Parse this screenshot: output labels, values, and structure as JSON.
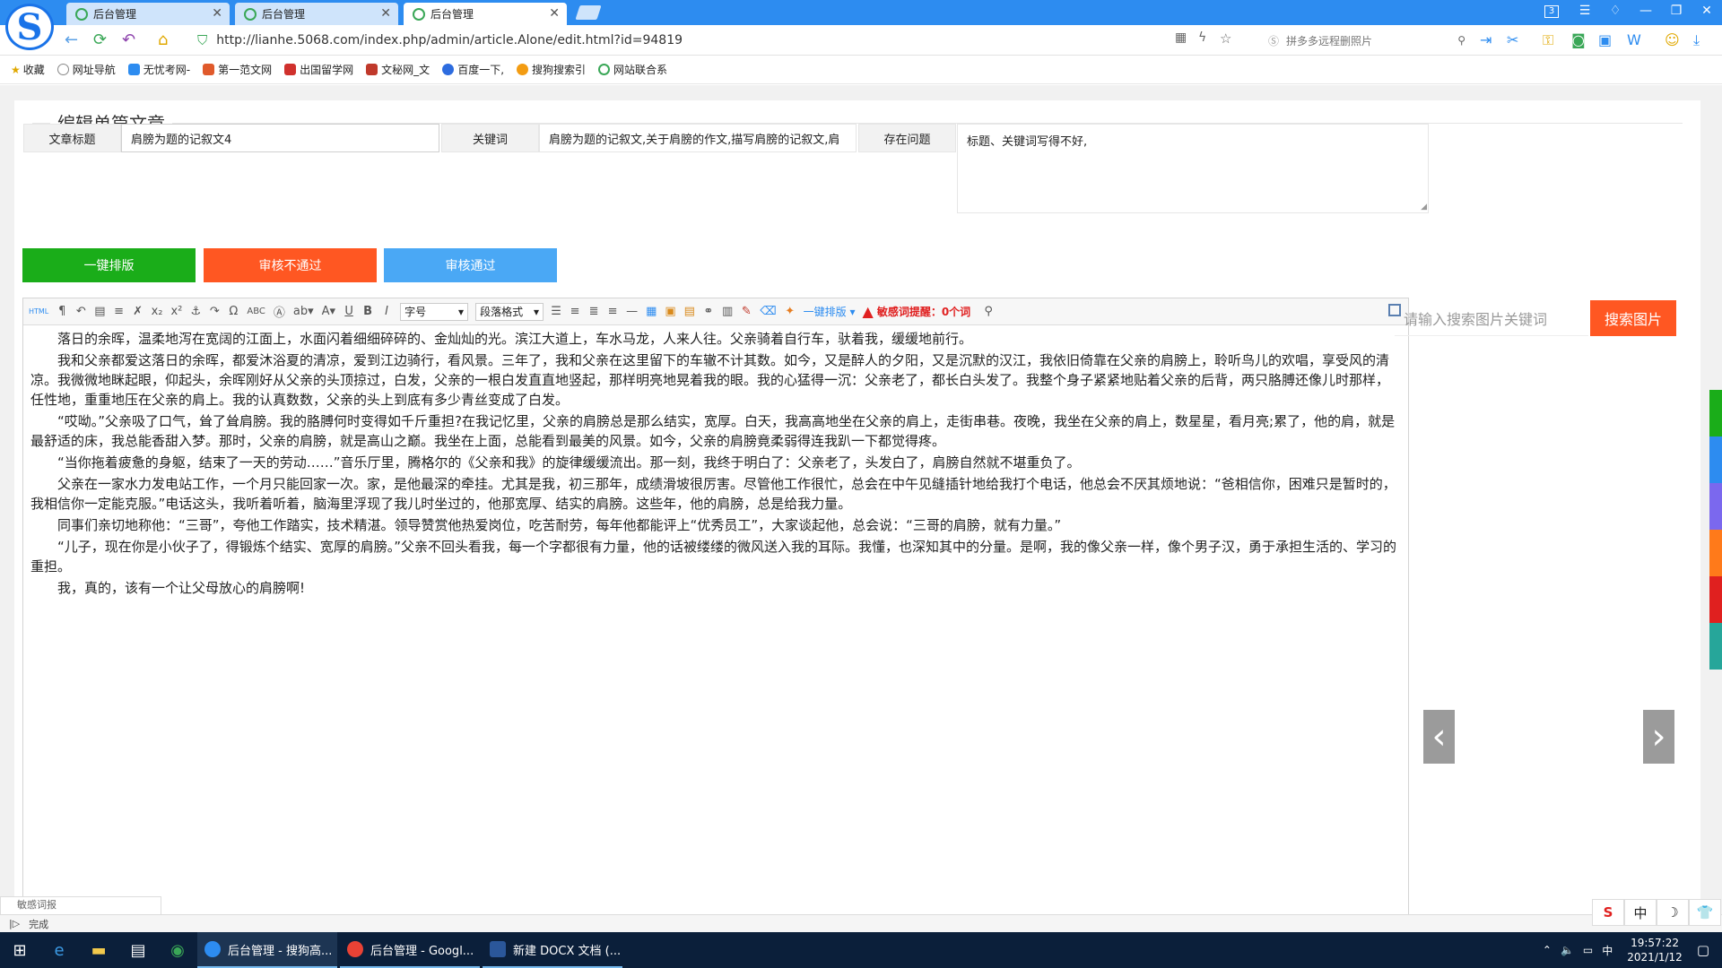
{
  "browser": {
    "tabs": [
      {
        "title": "后台管理",
        "active": false
      },
      {
        "title": "后台管理",
        "active": false
      },
      {
        "title": "后台管理",
        "active": true
      }
    ],
    "url": "http://lianhe.5068.com/index.php/admin/article.Alone/edit.html?id=94819",
    "search_placeholder": "拼多多远程删照片",
    "bookmarks": [
      "收藏",
      "网址导航",
      "无忧考网-",
      "第一范文网",
      "出国留学网",
      "文秘网_文",
      "百度一下,",
      "搜狗搜索引",
      "网站联合系"
    ],
    "tab_count_badge": "3"
  },
  "page": {
    "heading": "编辑单篇文章",
    "fields": {
      "title_label": "文章标题",
      "title_value": "肩膀为题的记叙文4",
      "keywords_label": "关键词",
      "keywords_value": "肩膀为题的记叙文,关于肩膀的作文,描写肩膀的记叙文,肩",
      "problem_label": "存在问题",
      "problem_value": "标题、关键词写得不好,"
    },
    "buttons": {
      "typeset": "一键排版",
      "reject": "审核不通过",
      "approve": "审核通过"
    },
    "colors": {
      "green": "#1aad19",
      "red": "#ff5722",
      "blue": "#4aa8f5"
    }
  },
  "editor": {
    "toolbar": {
      "font_size": "字号",
      "paragraph": "段落格式",
      "typeset": "一键排版",
      "sensitive_warning": "敏感词提醒：0个词"
    },
    "paragraphs": [
      "落日的余晖，温柔地泻在宽阔的江面上，水面闪着细细碎碎的、金灿灿的光。滨江大道上，车水马龙，人来人往。父亲骑着自行车，驮着我，缓缓地前行。",
      "我和父亲都爱这落日的余晖，都爱沐浴夏的清凉，爱到江边骑行，看风景。三年了，我和父亲在这里留下的车辙不计其数。如今，又是醉人的夕阳，又是沉默的汉江，我依旧倚靠在父亲的肩膀上，聆听鸟儿的欢唱，享受风的清凉。我微微地眯起眼，仰起头，余晖刚好从父亲的头顶掠过，白发，父亲的一根白发直直地竖起，那样明亮地晃着我的眼。我的心猛得一沉：父亲老了，都长白头发了。我整个身子紧紧地贴着父亲的后背，两只胳膊还像儿时那样，任性地，重重地压在父亲的肩上。我的认真数数，父亲的头上到底有多少青丝变成了白发。",
      "“哎呦。”父亲吸了口气，耸了耸肩膀。我的胳膊何时变得如千斤重担?在我记忆里，父亲的肩膀总是那么结实，宽厚。白天，我高高地坐在父亲的肩上，走街串巷。夜晚，我坐在父亲的肩上，数星星，看月亮;累了，他的肩，就是最舒适的床，我总能香甜入梦。那时，父亲的肩膀，就是高山之巅。我坐在上面，总能看到最美的风景。如今，父亲的肩膀竟柔弱得连我趴一下都觉得疼。",
      "“当你拖着疲惫的身躯，结束了一天的劳动……”音乐厅里，腾格尔的《父亲和我》的旋律缓缓流出。那一刻，我终于明白了：父亲老了，头发白了，肩膀自然就不堪重负了。",
      "父亲在一家水力发电站工作，一个月只能回家一次。家，是他最深的牵挂。尤其是我，初三那年，成绩滑坡很厉害。尽管他工作很忙，总会在中午见缝插针地给我打个电话，他总会不厌其烦地说：“爸相信你，困难只是暂时的，我相信你一定能克服。”电话这头，我听着听着，脑海里浮现了我儿时坐过的，他那宽厚、结实的肩膀。这些年，他的肩膀，总是给我力量。",
      "同事们亲切地称他：“三哥”，夸他工作踏实，技术精湛。领导赞赏他热爱岗位，吃苦耐劳，每年他都能评上“优秀员工”，大家谈起他，总会说：“三哥的肩膀，就有力量。”",
      "“儿子，现在你是小伙子了，得锻炼个结实、宽厚的肩膀。”父亲不回头看我，每一个字都很有力量，他的话被缕缕的微风送入我的耳际。我懂，也深知其中的分量。是啊，我的像父亲一样，像个男子汉，勇于承担生活的、学习的重担。",
      "我，真的，该有一个让父母放心的肩膀啊!"
    ]
  },
  "image_search": {
    "placeholder": "请输入搜索图片关键词",
    "button": "搜索图片"
  },
  "status": {
    "text": "完成",
    "mini_tab": "敏感词报"
  },
  "ime": [
    "S",
    "中",
    "☽",
    "👕"
  ],
  "taskbar": {
    "apps": [
      "后台管理 - 搜狗高...",
      "后台管理 - Googl...",
      "新建 DOCX 文档 (..."
    ],
    "time": "19:57:22",
    "date": "2021/1/12"
  }
}
